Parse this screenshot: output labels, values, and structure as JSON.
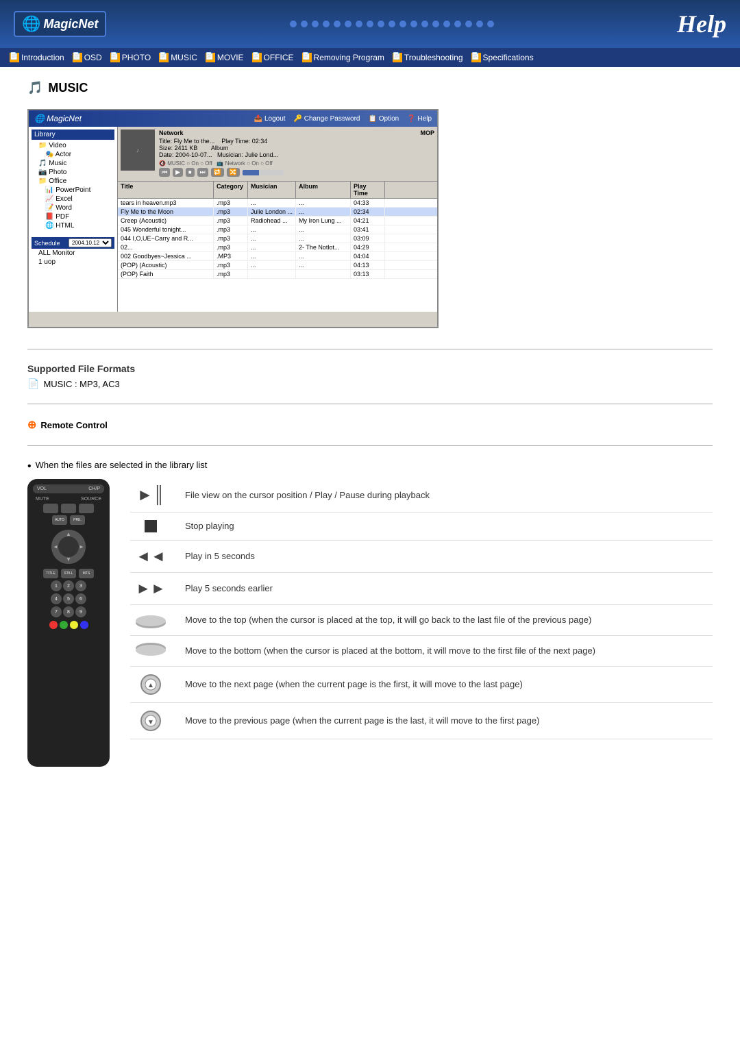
{
  "header": {
    "logo": "MagicNet",
    "help_title": "Help"
  },
  "nav": {
    "items": [
      {
        "label": "Introduction",
        "icon": "📄"
      },
      {
        "label": "OSD",
        "icon": "📄"
      },
      {
        "label": "PHOTO",
        "icon": "📄"
      },
      {
        "label": "MUSIC",
        "icon": "📄"
      },
      {
        "label": "MOVIE",
        "icon": "📄"
      },
      {
        "label": "OFFICE",
        "icon": "📄"
      },
      {
        "label": "Removing Program",
        "icon": "📄"
      },
      {
        "label": "Troubleshooting",
        "icon": "📄"
      },
      {
        "label": "Specifications",
        "icon": "📄"
      }
    ]
  },
  "main": {
    "section_title": "MUSIC",
    "screenshot": {
      "app_title": "MagicNet",
      "toolbar_items": [
        "Logout",
        "Change Password",
        "Option",
        "Help"
      ],
      "library_title": "Library",
      "tree_items": [
        "Video",
        "Actor",
        "Music",
        "Photo",
        "Office",
        "PowerPoint",
        "Excel",
        "Word",
        "PDF",
        "HTML"
      ],
      "schedule_label": "Schedule",
      "schedule_date": "2004.10.12",
      "schedule_items": [
        "ALL Monitor",
        "1 uop"
      ],
      "info": {
        "network_label": "Network",
        "title_label": "Title",
        "title_value": "Fly Me to the...",
        "play_time_label": "Play Time",
        "play_time_value": "02:34",
        "size_label": "Size",
        "size_value": "2411 KB",
        "album_label": "Album",
        "date_label": "Date",
        "date_value": "2004-10-07...",
        "musician_label": "Musician",
        "musician_value": "Julie Lond..."
      },
      "columns": [
        "Title",
        "Category",
        "Musician",
        "Album",
        "Play Time"
      ],
      "playlist": [
        {
          "title": "tears in heaven.mp3",
          "category": ".mp3",
          "musician": "...",
          "album": "...",
          "time": "04:33"
        },
        {
          "title": "Fly Me to the Moon",
          "category": ".mp3",
          "musician": "Julie London ...",
          "album": "...",
          "time": "02:34"
        },
        {
          "title": "Creep (Acoustic)",
          "category": ".mp3",
          "musician": "Radiohead ...",
          "album": "My Iron Lung ...",
          "time": "04:21"
        },
        {
          "title": "045 Wonderful tonight...",
          "category": ".mp3",
          "musician": "...",
          "album": "...",
          "time": "03:41"
        },
        {
          "title": "044 I,O,UE~Carry and R...",
          "category": ".mp3",
          "musician": "...",
          "album": "...",
          "time": "03:09"
        },
        {
          "title": "02...",
          "category": ".mp3",
          "musician": "...",
          "album": "2- The Notlot...",
          "time": "04:29"
        },
        {
          "title": "002 Goodbyes~Jessica ...",
          "category": ".MP3",
          "musician": "...",
          "album": "...",
          "time": "04:04"
        },
        {
          "title": "(POP) (Acoustic)",
          "category": ".mp3",
          "musician": "...",
          "album": "...",
          "time": "04:13"
        },
        {
          "title": "(POP) Faith",
          "category": ".mp3",
          "musician": "",
          "album": "",
          "time": "03:13"
        }
      ]
    },
    "supported_formats": {
      "title": "Supported File Formats",
      "items": [
        "MUSIC : MP3, AC3"
      ]
    },
    "remote_control": {
      "title": "Remote Control"
    },
    "bullet_item": "When the files are selected in the library list",
    "controls": [
      {
        "icon_type": "play_pause",
        "icon_text": "►║",
        "description": "File view on the cursor position / Play / Pause during playback"
      },
      {
        "icon_type": "stop",
        "icon_text": "■",
        "description": "Stop playing"
      },
      {
        "icon_type": "rewind",
        "icon_text": "◄◄",
        "description": "Play in 5 seconds"
      },
      {
        "icon_type": "forward",
        "icon_text": "►►",
        "description": "Play 5 seconds earlier"
      },
      {
        "icon_type": "scroll_up",
        "description": "Move to the top (when the cursor is placed at the top, it will go back to the last file of the previous page)"
      },
      {
        "icon_type": "scroll_down",
        "description": "Move to the bottom (when the cursor is placed at the bottom, it will move to the first file of the next page)"
      },
      {
        "icon_type": "circle_up",
        "description": "Move to the next page (when the current page is the first, it will move to the last page)"
      },
      {
        "icon_type": "circle_down",
        "description": "Move to the previous page (when the current page is the last, it will move to the first page)"
      }
    ]
  }
}
